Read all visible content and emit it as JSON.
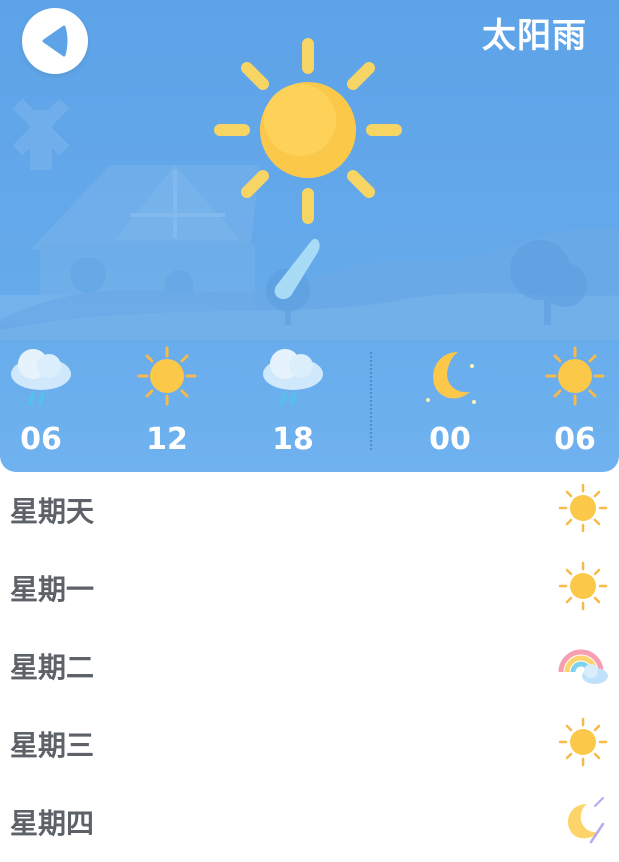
{
  "header": {
    "title": "太阳雨",
    "back_icon": "back-arrow-icon",
    "main_icon": "sun-rain-icon"
  },
  "hourly": [
    {
      "time": "06",
      "icon": "rain-cloud-icon"
    },
    {
      "time": "12",
      "icon": "sun-icon"
    },
    {
      "time": "18",
      "icon": "rain-cloud-icon"
    },
    {
      "time": "00",
      "icon": "moon-icon"
    },
    {
      "time": "06",
      "icon": "sun-icon"
    }
  ],
  "daily": [
    {
      "day": "星期天",
      "icon": "sun-icon"
    },
    {
      "day": "星期一",
      "icon": "sun-icon"
    },
    {
      "day": "星期二",
      "icon": "rainbow-cloud-icon"
    },
    {
      "day": "星期三",
      "icon": "sun-icon"
    },
    {
      "day": "星期四",
      "icon": "moon-meteor-icon"
    }
  ],
  "colors": {
    "sky": "#5ea3e8",
    "sun": "#fcc84a",
    "text_white": "#ffffff",
    "day_text": "#5d6168"
  }
}
